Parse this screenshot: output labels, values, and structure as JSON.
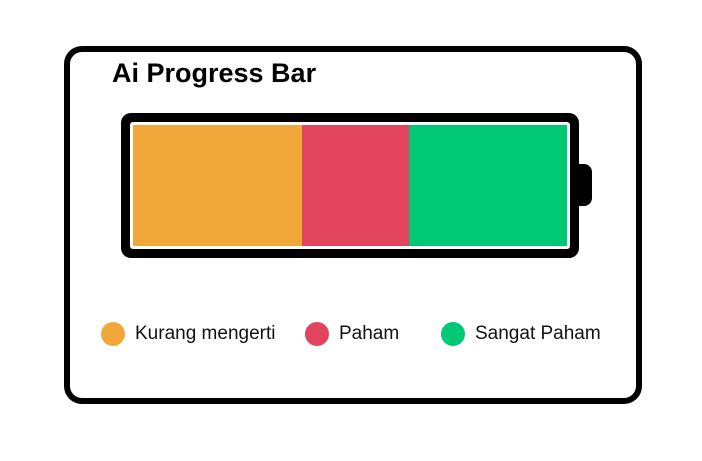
{
  "title": "Ai Progress Bar",
  "progress": {
    "segments": [
      {
        "label": "Kurang mengerti",
        "fraction": 0.39,
        "color": "#F2A73B"
      },
      {
        "label": "Paham",
        "fraction": 0.245,
        "color": "#E1445C"
      },
      {
        "label": "Sangat Paham",
        "fraction": 0.365,
        "color": "#00C875"
      }
    ]
  },
  "legend": {
    "items": [
      {
        "label": "Kurang mengerti",
        "color": "#F2A73B"
      },
      {
        "label": "Paham",
        "color": "#E1445C"
      },
      {
        "label": "Sangat Paham",
        "color": "#00C875"
      }
    ]
  }
}
